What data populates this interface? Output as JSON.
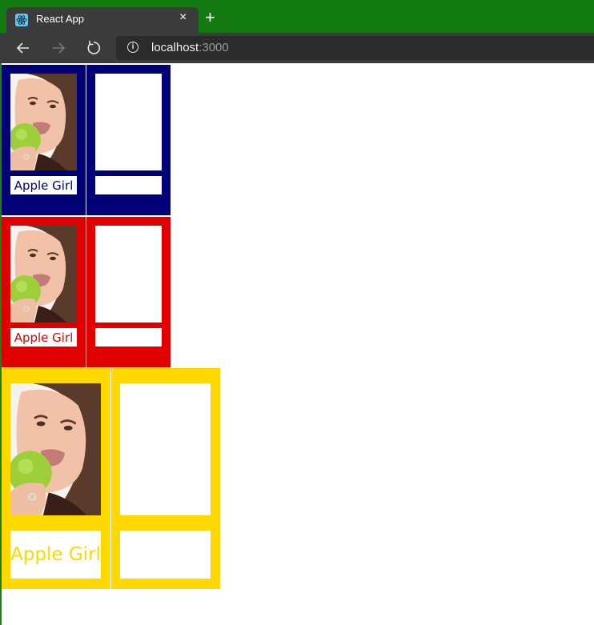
{
  "browser": {
    "tab_title": "React App",
    "tab_close": "×",
    "new_tab": "+",
    "url_host": "localhost",
    "url_port": ":3000",
    "frame_color": "#127a10"
  },
  "rows": [
    {
      "color": "#020077",
      "cards": [
        {
          "label": "Apple Girl",
          "image": "apple-girl-photo"
        },
        {
          "label": "",
          "image": "blank"
        }
      ]
    },
    {
      "color": "#e00000",
      "cards": [
        {
          "label": "Apple Girl",
          "image": "apple-girl-photo"
        },
        {
          "label": "",
          "image": "blank"
        }
      ]
    },
    {
      "color": "#ffd800",
      "cards": [
        {
          "label": "Apple Girl",
          "image": "apple-girl-photo"
        },
        {
          "label": "",
          "image": "blank"
        }
      ]
    }
  ]
}
